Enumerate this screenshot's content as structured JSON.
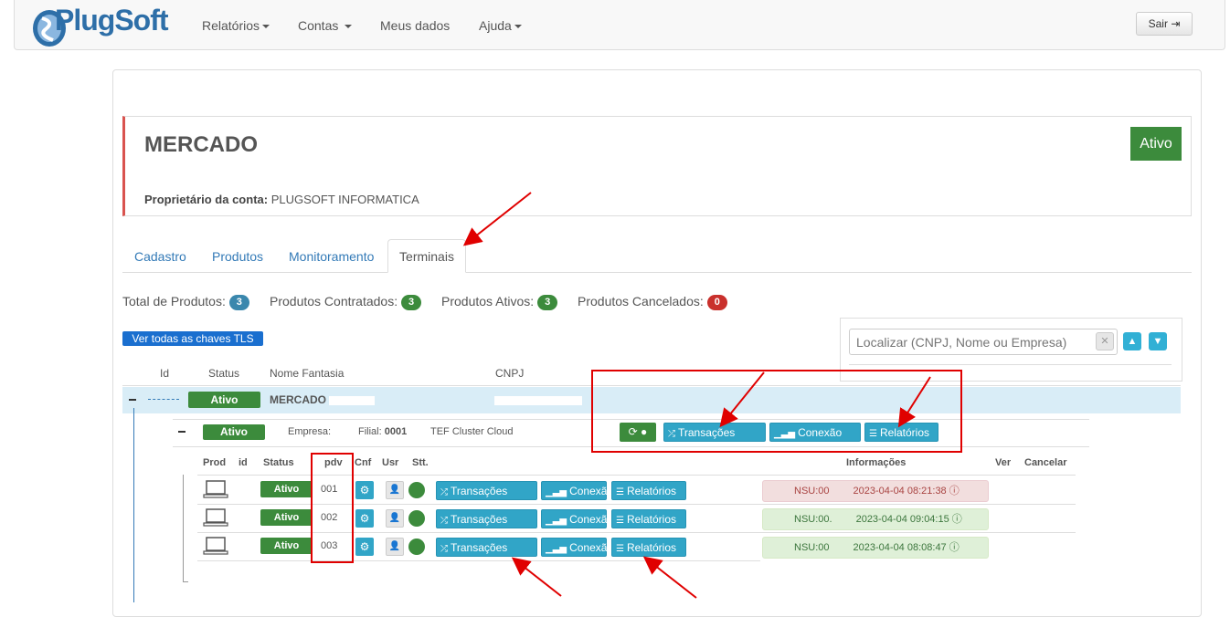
{
  "navbar": {
    "brand": "PlugSoft",
    "menu": [
      "Relatórios",
      "Contas",
      "Meus dados",
      "Ajuda"
    ],
    "logout": "Sair"
  },
  "account": {
    "name": "MERCADO",
    "owner_label": "Proprietário da conta:",
    "owner_value": "PLUGSOFT INFORMATICA",
    "status": "Ativo"
  },
  "tabs": [
    "Cadastro",
    "Produtos",
    "Monitoramento",
    "Terminais"
  ],
  "stats": [
    {
      "label": "Total de Produtos:",
      "value": "3",
      "color": "#3a87ad"
    },
    {
      "label": "Produtos Contratados:",
      "value": "3",
      "color": "#3c8b3c"
    },
    {
      "label": "Produtos Ativos:",
      "value": "3",
      "color": "#3c8b3c"
    },
    {
      "label": "Produtos Cancelados:",
      "value": "0",
      "color": "#c9302c"
    }
  ],
  "tls_button": "Ver todas as chaves TLS",
  "search": {
    "placeholder": "Localizar (CNPJ, Nome ou Empresa)"
  },
  "table_headers": {
    "id": "Id",
    "status": "Status",
    "name": "Nome Fantasia",
    "cnpj": "CNPJ"
  },
  "company_row": {
    "status": "Ativo",
    "name": "MERCADO"
  },
  "branch_row": {
    "status": "Ativo",
    "empresa_label": "Empresa:",
    "filial_label": "Filial:",
    "filial_value": "0001",
    "product": "TEF Cluster Cloud",
    "btn_transacoes": "Transações",
    "btn_conexao": "Conexão",
    "btn_relatorios": "Relatórios"
  },
  "terminal_headers": {
    "prod": "Prod",
    "id": "id",
    "status": "Status",
    "pdv": "pdv",
    "cnf": "Cnf",
    "usr": "Usr",
    "stt": "Stt.",
    "info": "Informações",
    "ver": "Ver",
    "cancel": "Cancelar"
  },
  "terminals": [
    {
      "status": "Ativo",
      "pdv": "001",
      "nsu": "NSU:00",
      "datetime": "2023-04-04 08:21:38",
      "state": "red"
    },
    {
      "status": "Ativo",
      "pdv": "002",
      "nsu": "NSU:00.",
      "datetime": "2023-04-04 09:04:15",
      "state": "green"
    },
    {
      "status": "Ativo",
      "pdv": "003",
      "nsu": "NSU:00",
      "datetime": "2023-04-04 08:08:47",
      "state": "green"
    }
  ],
  "terminal_buttons": {
    "transacoes": "Transações",
    "conexao": "Conexão",
    "relatorios": "Relatórios"
  }
}
